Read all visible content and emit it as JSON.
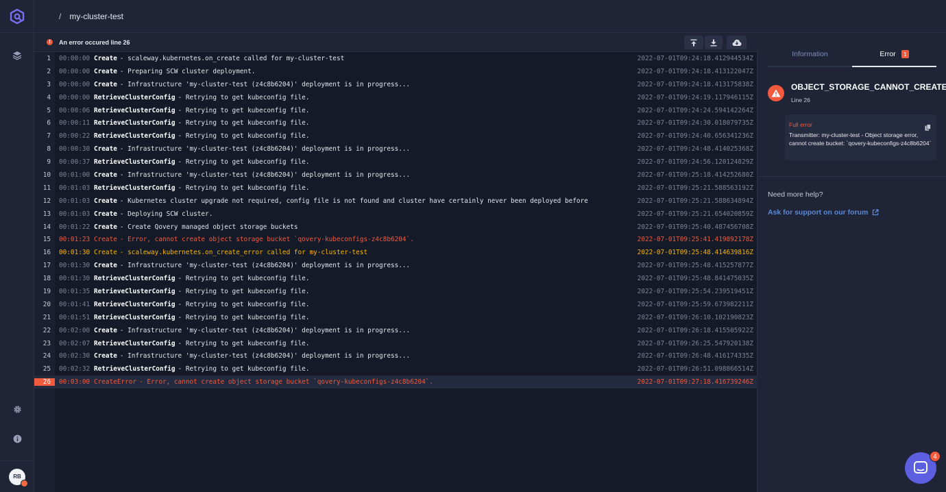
{
  "header": {
    "separator": "/",
    "cluster_name": "my-cluster-test"
  },
  "sidebar": {
    "avatar_initials": "RB"
  },
  "log_panel": {
    "error_title": "An error occured line 26",
    "error_badge": "!",
    "rows": [
      {
        "line": "1",
        "time": "00:00:00",
        "step": "Create",
        "msg": " - scaleway.kubernetes.on_create called for my-cluster-test",
        "date": "2022-07-01T09:24:18.412944534Z",
        "kind": ""
      },
      {
        "line": "2",
        "time": "00:00:00",
        "step": "Create",
        "msg": " - Preparing SCW cluster deployment.",
        "date": "2022-07-01T09:24:18.413122047Z",
        "kind": ""
      },
      {
        "line": "3",
        "time": "00:00:00",
        "step": "Create",
        "msg": " - Infrastructure 'my-cluster-test (z4c8b6204)' deployment is in progress...",
        "date": "2022-07-01T09:24:18.413175838Z",
        "kind": ""
      },
      {
        "line": "4",
        "time": "00:00:00",
        "step": "RetrieveClusterConfig",
        "msg": " - Retrying to get kubeconfig file.",
        "date": "2022-07-01T09:24:19.117946115Z",
        "kind": ""
      },
      {
        "line": "5",
        "time": "00:00:06",
        "step": "RetrieveClusterConfig",
        "msg": " - Retrying to get kubeconfig file.",
        "date": "2022-07-01T09:24:24.594142264Z",
        "kind": ""
      },
      {
        "line": "6",
        "time": "00:00:11",
        "step": "RetrieveClusterConfig",
        "msg": " - Retrying to get kubeconfig file.",
        "date": "2022-07-01T09:24:30.018079735Z",
        "kind": ""
      },
      {
        "line": "7",
        "time": "00:00:22",
        "step": "RetrieveClusterConfig",
        "msg": " - Retrying to get kubeconfig file.",
        "date": "2022-07-01T09:24:40.656341236Z",
        "kind": ""
      },
      {
        "line": "8",
        "time": "00:00:30",
        "step": "Create",
        "msg": " - Infrastructure 'my-cluster-test (z4c8b6204)' deployment is in progress...",
        "date": "2022-07-01T09:24:48.414025368Z",
        "kind": ""
      },
      {
        "line": "9",
        "time": "00:00:37",
        "step": "RetrieveClusterConfig",
        "msg": " - Retrying to get kubeconfig file.",
        "date": "2022-07-01T09:24:56.120124829Z",
        "kind": ""
      },
      {
        "line": "10",
        "time": "00:01:00",
        "step": "Create",
        "msg": " - Infrastructure 'my-cluster-test (z4c8b6204)' deployment is in progress...",
        "date": "2022-07-01T09:25:18.414252680Z",
        "kind": ""
      },
      {
        "line": "11",
        "time": "00:01:03",
        "step": "RetrieveClusterConfig",
        "msg": " - Retrying to get kubeconfig file.",
        "date": "2022-07-01T09:25:21.588563192Z",
        "kind": ""
      },
      {
        "line": "12",
        "time": "00:01:03",
        "step": "Create",
        "msg": " - Kubernetes cluster upgrade not required, config file is not found and cluster have certainly never been deployed before",
        "date": "2022-07-01T09:25:21.588634894Z",
        "kind": ""
      },
      {
        "line": "13",
        "time": "00:01:03",
        "step": "Create",
        "msg": " - Deploying SCW cluster.",
        "date": "2022-07-01T09:25:21.654020859Z",
        "kind": ""
      },
      {
        "line": "14",
        "time": "00:01:22",
        "step": "Create",
        "msg": " - Create Qovery managed object storage buckets",
        "date": "2022-07-01T09:25:40.487456708Z",
        "kind": ""
      },
      {
        "line": "15",
        "time": "00:01:23",
        "step": "Create",
        "msg": " - Error, cannot create object storage bucket `qovery-kubeconfigs-z4c8b6204`.",
        "date": "2022-07-01T09:25:41.419892178Z",
        "kind": "error"
      },
      {
        "line": "16",
        "time": "00:01:30",
        "step": "Create",
        "msg": " - scaleway.kubernetes.on_create_error called for my-cluster-test",
        "date": "2022-07-01T09:25:48.414639816Z",
        "kind": "warn"
      },
      {
        "line": "17",
        "time": "00:01:30",
        "step": "Create",
        "msg": " - Infrastructure 'my-cluster-test (z4c8b6204)' deployment is in progress...",
        "date": "2022-07-01T09:25:48.415257877Z",
        "kind": ""
      },
      {
        "line": "18",
        "time": "00:01:30",
        "step": "RetrieveClusterConfig",
        "msg": " - Retrying to get kubeconfig file.",
        "date": "2022-07-01T09:25:48.841475035Z",
        "kind": ""
      },
      {
        "line": "19",
        "time": "00:01:35",
        "step": "RetrieveClusterConfig",
        "msg": " - Retrying to get kubeconfig file.",
        "date": "2022-07-01T09:25:54.239519451Z",
        "kind": ""
      },
      {
        "line": "20",
        "time": "00:01:41",
        "step": "RetrieveClusterConfig",
        "msg": " - Retrying to get kubeconfig file.",
        "date": "2022-07-01T09:25:59.673982211Z",
        "kind": ""
      },
      {
        "line": "21",
        "time": "00:01:51",
        "step": "RetrieveClusterConfig",
        "msg": " - Retrying to get kubeconfig file.",
        "date": "2022-07-01T09:26:10.102190823Z",
        "kind": ""
      },
      {
        "line": "22",
        "time": "00:02:00",
        "step": "Create",
        "msg": " - Infrastructure 'my-cluster-test (z4c8b6204)' deployment is in progress...",
        "date": "2022-07-01T09:26:18.415505922Z",
        "kind": ""
      },
      {
        "line": "23",
        "time": "00:02:07",
        "step": "RetrieveClusterConfig",
        "msg": " - Retrying to get kubeconfig file.",
        "date": "2022-07-01T09:26:25.547920138Z",
        "kind": ""
      },
      {
        "line": "24",
        "time": "00:02:30",
        "step": "Create",
        "msg": " - Infrastructure 'my-cluster-test (z4c8b6204)' deployment is in progress...",
        "date": "2022-07-01T09:26:48.416174335Z",
        "kind": ""
      },
      {
        "line": "25",
        "time": "00:02:32",
        "step": "RetrieveClusterConfig",
        "msg": " - Retrying to get kubeconfig file.",
        "date": "2022-07-01T09:26:51.098866514Z",
        "kind": ""
      },
      {
        "line": "26",
        "time": "00:03:00",
        "step": "CreateError",
        "msg": " - Error, cannot create object storage bucket `qovery-kubeconfigs-z4c8b6204`.",
        "date": "2022-07-01T09:27:18.416739246Z",
        "kind": "error current"
      }
    ]
  },
  "side_panel": {
    "tab_information": "Information",
    "tab_error": "Error",
    "tab_error_count": "1",
    "error_code": "OBJECT_STORAGE_CANNOT_CREATE...",
    "error_line": "Line 26",
    "full_error_title": "Full error",
    "full_error_body": "Transmitter: my-cluster-test - Object storage error, cannot create bucket: `qovery-kubeconfigs-z4c8b6204`",
    "help_question": "Need more help?",
    "help_link": "Ask for support on our forum"
  },
  "chat": {
    "unread": "4"
  },
  "colors": {
    "error": "#f25a3e",
    "warning": "#f7b500",
    "link": "#5c88d6",
    "chat": "#5b5fe0"
  }
}
